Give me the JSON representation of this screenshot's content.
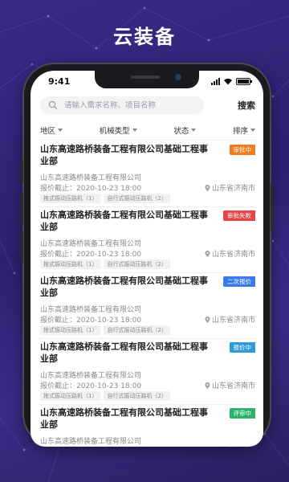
{
  "hero": {
    "title": "云装备"
  },
  "status_bar": {
    "time": "9:41"
  },
  "search": {
    "placeholder": "请输入需求名称、项目名称",
    "button_label": "搜索"
  },
  "filters": [
    {
      "label": "地区"
    },
    {
      "label": "机械类型"
    },
    {
      "label": "状态"
    },
    {
      "label": "排序"
    }
  ],
  "cards": [
    {
      "title": "山东高速路桥装备工程有限公司基础工程事业部",
      "badge": "审批中",
      "badge_color": "#f07c1e",
      "company": "山东高速路桥装备工程有限公司",
      "deadline": "报价截止：2020-10-23 18:00",
      "location": "山东省济南市",
      "tags": [
        "拖式振动压路机（1）",
        "自行式振动压路机（2）"
      ]
    },
    {
      "title": "山东高速路桥装备工程有限公司基础工程事业部",
      "badge": "审批失败",
      "badge_color": "#e64545",
      "company": "山东高速路桥装备工程有限公司",
      "deadline": "报价截止：2020-10-23 18:00",
      "location": "山东省济南市",
      "tags": [
        "拖式振动压路机（1）",
        "自行式振动压路机（2）"
      ]
    },
    {
      "title": "山东高速路桥装备工程有限公司基础工程事业部",
      "badge": "二次报价",
      "badge_color": "#3a7be8",
      "company": "山东高速路桥装备工程有限公司",
      "deadline": "报价截止：2020-10-23 18:00",
      "location": "山东省济南市",
      "tags": [
        "拖式振动压路机（1）",
        "自行式振动压路机（2）"
      ]
    },
    {
      "title": "山东高速路桥装备工程有限公司基础工程事业部",
      "badge": "报价中",
      "badge_color": "#2e9bd6",
      "company": "山东高速路桥装备工程有限公司",
      "deadline": "报价截止：2020-10-23 18:00",
      "location": "山东省济南市",
      "tags": [
        "拖式振动压路机（1）",
        "自行式振动压路机（2）"
      ]
    },
    {
      "title": "山东高速路桥装备工程有限公司基础工程事业部",
      "badge": "评审中",
      "badge_color": "#2bb36b",
      "company": "山东高速路桥装备工程有限公司",
      "deadline": "",
      "location": "",
      "tags": []
    }
  ]
}
